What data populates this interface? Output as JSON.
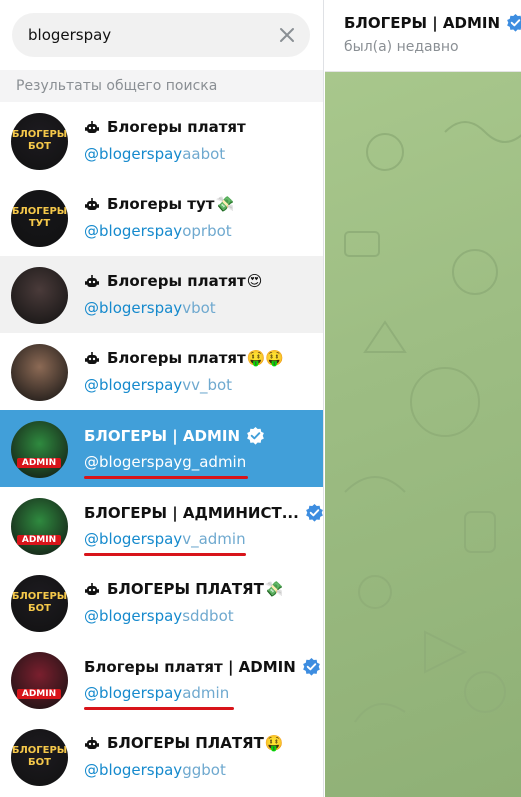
{
  "search": {
    "value": "blogerspay"
  },
  "section_header": "Результаты общего поиска",
  "results": [
    {
      "prefix_icon": "bot-icon",
      "title": "Блогеры платят",
      "emoji": "",
      "verified": false,
      "user_match": "@blogerspay",
      "user_rest": "aabot",
      "avatar": "БЛОГЕРЫ БОТ",
      "avatar_color": "#1d1b20"
    },
    {
      "prefix_icon": "bot-icon",
      "title": "Блогеры тут",
      "emoji": "💸",
      "verified": false,
      "user_match": "@blogerspay",
      "user_rest": "oprbot",
      "avatar": "БЛОГЕРЫ ТУТ",
      "avatar_color": "#16161a"
    },
    {
      "prefix_icon": "bot-icon",
      "title": "Блогеры платят",
      "emoji": "😍",
      "verified": false,
      "user_match": "@blogerspay",
      "user_rest": "vbot",
      "avatar": "",
      "avatar_color": "#4a3b3a"
    },
    {
      "prefix_icon": "bot-icon",
      "title": "Блогеры платят",
      "emoji": "🤑🤑",
      "verified": false,
      "user_match": "@blogerspay",
      "user_rest": "vv_bot",
      "avatar": "",
      "avatar_color": "#8c6a55"
    },
    {
      "prefix_icon": "",
      "title": "БЛОГЕРЫ | ADMIN",
      "emoji": "",
      "verified": true,
      "user_match": "@blogerspay",
      "user_rest": "g_admin",
      "avatar": "ADMIN",
      "avatar_color": "#2f8a3f",
      "selected": true
    },
    {
      "prefix_icon": "",
      "title": "БЛОГЕРЫ | АДМИНИСТ...",
      "emoji": "",
      "verified": true,
      "user_match": "@blogerspay",
      "user_rest": "v_admin",
      "avatar": "ADMIN",
      "avatar_color": "#2f8a3f"
    },
    {
      "prefix_icon": "bot-icon",
      "title": "БЛОГЕРЫ ПЛАТЯТ",
      "emoji": "💸",
      "verified": false,
      "user_match": "@blogerspay",
      "user_rest": "sddbot",
      "avatar": "БЛОГЕРЫ БОТ",
      "avatar_color": "#1d1b20"
    },
    {
      "prefix_icon": "",
      "title": "Блогеры платят | ADMIN",
      "emoji": "",
      "verified": true,
      "user_match": "@blogerspay",
      "user_rest": "admin",
      "avatar": "ADMIN",
      "avatar_color": "#7a1f2e"
    },
    {
      "prefix_icon": "bot-icon",
      "title": "БЛОГЕРЫ ПЛАТЯТ",
      "emoji": "🤑",
      "verified": false,
      "user_match": "@blogerspay",
      "user_rest": "ggbot",
      "avatar": "БЛОГЕРЫ БОТ",
      "avatar_color": "#1d1b20"
    }
  ],
  "chat": {
    "title": "БЛОГЕРЫ | ADMIN",
    "status": "был(а) недавно",
    "verified": true
  },
  "colors": {
    "accent": "#419fd9",
    "link": "#168acd",
    "underline": "#d8141a",
    "verified": "#3d8de0"
  }
}
